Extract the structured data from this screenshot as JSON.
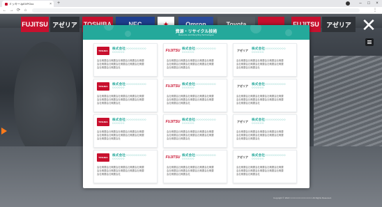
{
  "browser": {
    "tab_title": "ミッキーJpEXPOxx",
    "tab_close": "×",
    "new_tab": "+",
    "nav": {
      "back": "←",
      "forward": "→",
      "reload": "⟳",
      "home": "⌂"
    },
    "window": {
      "minimize": "–",
      "maximize": "□",
      "close": "×"
    },
    "menu": "⋮"
  },
  "scene": {
    "banners": [
      {
        "text": "FUJITSU",
        "bg": "#c8102e",
        "color": "#ffffff"
      },
      {
        "text": "アゼリア",
        "bg": "#2f3338",
        "color": "#ffffff"
      },
      {
        "text": "TOSHIBA",
        "bg": "#c8102e",
        "color": "#ffffff"
      },
      {
        "text": "NEC",
        "bg": "#1e3f8f",
        "color": "#ffffff"
      },
      {
        "text": "✦",
        "bg": "#ffffff",
        "color": "#d0021b"
      },
      {
        "text": "Omron",
        "bg": "#2a4b9b",
        "color": "#ffffff"
      },
      {
        "text": "Toyota",
        "bg": "#555b61",
        "color": "#ffffff"
      },
      {
        "text": "",
        "bg": "#c8102e",
        "color": "#ffffff"
      },
      {
        "text": "FUJITSU",
        "bg": "#c8102e",
        "color": "#ffffff"
      },
      {
        "text": "アゼリア",
        "bg": "#2f3338",
        "color": "#ffffff"
      }
    ],
    "close_symbol": "✕",
    "footnote": "Copyright © 2022 ×××××××××××××××××× All Rights Reserved."
  },
  "modal": {
    "title": "資源・リサイクル技術",
    "subtitle": "Resource and Recycling Technologies",
    "accent": "#24a99b",
    "cards": [
      {
        "logo": "TOSHIBA",
        "logo_type": "toshiba",
        "name_l1": "株式会社○○○○○○○○○○",
        "name_l2": "○○○○○○",
        "desc_l1": "会社概要会社概要会社概要会社概要会社概要",
        "desc_l2": "会社概要会社概要会社概要会社概要会社概要",
        "desc_l3": "会社概要会社概要会社"
      },
      {
        "logo": "FUJITSU",
        "logo_type": "fujitsu",
        "name_l1": "株式会社○○○○○○○○○○",
        "name_l2": "○○○○○○",
        "desc_l1": "会社概要会社概要会社概要会社概要会社概要",
        "desc_l2": "会社概要会社概要会社概要会社概要会社概要",
        "desc_l3": "会社概要会社概要会社"
      },
      {
        "logo": "アゼリア",
        "logo_type": "azbil",
        "name_l1": "株式会社○○○○○○○○○○",
        "name_l2": "○○○○○○",
        "desc_l1": "会社概要会社概要会社概要会社概要会社概要",
        "desc_l2": "会社概要会社概要会社概要会社概要会社概要",
        "desc_l3": "会社概要会社概要会社"
      },
      {
        "logo": "TOSHIBA",
        "logo_type": "toshiba",
        "name_l1": "株式会社○○○○○○○○○○",
        "name_l2": "○○○○○○",
        "desc_l1": "会社概要会社概要会社概要会社概要会社概要",
        "desc_l2": "会社概要会社概要会社概要会社概要会社概要",
        "desc_l3": "会社概要会社概要会社"
      },
      {
        "logo": "FUJITSU",
        "logo_type": "fujitsu",
        "name_l1": "株式会社○○○○○○○○○○",
        "name_l2": "○○○○○○",
        "desc_l1": "会社概要会社概要会社概要会社概要会社概要",
        "desc_l2": "会社概要会社概要会社概要会社概要会社概要",
        "desc_l3": "会社概要会社概要会社"
      },
      {
        "logo": "アゼリア",
        "logo_type": "azbil",
        "name_l1": "株式会社○○○○○○○○○○",
        "name_l2": "○○○○○○",
        "desc_l1": "会社概要会社概要会社概要会社概要会社概要",
        "desc_l2": "会社概要会社概要会社概要会社概要会社概要",
        "desc_l3": "会社概要会社概要会社"
      },
      {
        "logo": "TOSHIBA",
        "logo_type": "toshiba",
        "name_l1": "株式会社○○○○○○○○○○",
        "name_l2": "○○○○○○",
        "desc_l1": "会社概要会社概要会社概要会社概要会社概要",
        "desc_l2": "会社概要会社概要会社概要会社概要会社概要",
        "desc_l3": "会社概要会社概要会社"
      },
      {
        "logo": "FUJITSU",
        "logo_type": "fujitsu",
        "name_l1": "株式会社○○○○○○○○○○",
        "name_l2": "○○○○○○",
        "desc_l1": "会社概要会社概要会社概要会社概要会社概要",
        "desc_l2": "会社概要会社概要会社概要会社概要会社概要",
        "desc_l3": "会社概要会社概要会社"
      },
      {
        "logo": "アゼリア",
        "logo_type": "azbil",
        "name_l1": "株式会社○○○○○○○○○○",
        "name_l2": "○○○○○○",
        "desc_l1": "会社概要会社概要会社概要会社概要会社概要",
        "desc_l2": "会社概要会社概要会社概要会社概要会社概要",
        "desc_l3": "会社概要会社概要会社"
      },
      {
        "logo": "TOSHIBA",
        "logo_type": "toshiba",
        "name_l1": "株式会社○○○○○○○○○○",
        "name_l2": "○○○○○○",
        "desc_l1": "会社概要会社概要会社概要会社概要会社概要",
        "desc_l2": "会社概要会社概要会社概要会社概要会社概要",
        "desc_l3": "会社概要会社概要会社"
      },
      {
        "logo": "FUJITSU",
        "logo_type": "fujitsu",
        "name_l1": "株式会社○○○○○○○○○○",
        "name_l2": "○○○○○○",
        "desc_l1": "会社概要会社概要会社概要会社概要会社概要",
        "desc_l2": "会社概要会社概要会社概要会社概要会社概要",
        "desc_l3": "会社概要会社概要会社"
      },
      {
        "logo": "アゼリア",
        "logo_type": "azbil",
        "name_l1": "株式会社○○○○○○○○○○",
        "name_l2": "○○○○○○",
        "desc_l1": "会社概要会社概要会社概要会社概要会社概要",
        "desc_l2": "会社概要会社概要会社概要会社概要会社概要",
        "desc_l3": "会社概要会社概要会社"
      }
    ]
  }
}
